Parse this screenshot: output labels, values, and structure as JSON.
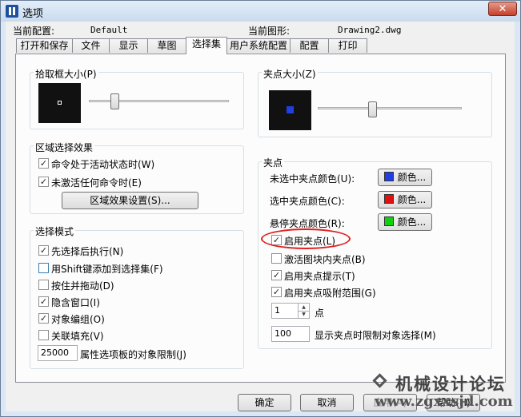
{
  "window": {
    "title": "选项",
    "close": "✕"
  },
  "profile": {
    "label": "当前配置:",
    "value": "Default"
  },
  "drawing": {
    "label": "当前图形:",
    "value": "Drawing2.dwg"
  },
  "tabs": [
    "打开和保存",
    "文件",
    "显示",
    "草图",
    "选择集",
    "用户系统配置",
    "配置",
    "打印"
  ],
  "active_tab": "选择集",
  "pickbox": {
    "title": "拾取框大小(P)",
    "level": 0.18
  },
  "gripsize": {
    "title": "夹点大小(Z)",
    "level": 0.38
  },
  "area_effect": {
    "title": "区域选择效果",
    "active_cmd": "命令处于活动状态时(W)",
    "no_cmd": "未激活任何命令时(E)",
    "button": "区域效果设置(S)..."
  },
  "selection_modes": {
    "title": "选择模式",
    "items": [
      {
        "label": "先选择后执行(N)",
        "checked": true
      },
      {
        "label": "用Shift键添加到选择集(F)",
        "checked": false
      },
      {
        "label": "按住并拖动(D)",
        "checked": false
      },
      {
        "label": "隐含窗口(I)",
        "checked": true
      },
      {
        "label": "对象编组(O)",
        "checked": true
      },
      {
        "label": "关联填充(V)",
        "checked": false
      }
    ],
    "limit_value": "25000",
    "limit_label": "属性选项板的对象限制(J)"
  },
  "grips": {
    "title": "夹点",
    "unselected": {
      "label": "未选中夹点颜色(U):",
      "button": "颜色...",
      "color": "#1f3fe0"
    },
    "selected": {
      "label": "选中夹点颜色(C):",
      "button": "颜色...",
      "color": "#e01010"
    },
    "hover": {
      "label": "悬停夹点颜色(R):",
      "button": "颜色...",
      "color": "#10d010"
    },
    "enable_grips": "启用夹点(L)",
    "enable_block_grips": "激活图块内夹点(B)",
    "enable_tips": "启用夹点提示(T)",
    "enable_snap": "启用夹点吸附范围(G)",
    "spinner_value": "1",
    "spinner_unit": "点",
    "limit_value": "100",
    "limit_label": "显示夹点时限制对象选择(M)"
  },
  "footer": {
    "ok": "确定",
    "cancel": "取消",
    "apply": "应用(A)",
    "help": "帮助(H)"
  },
  "watermark": {
    "title": "机械设计论坛",
    "url": "www.zgxxsjd.com"
  }
}
